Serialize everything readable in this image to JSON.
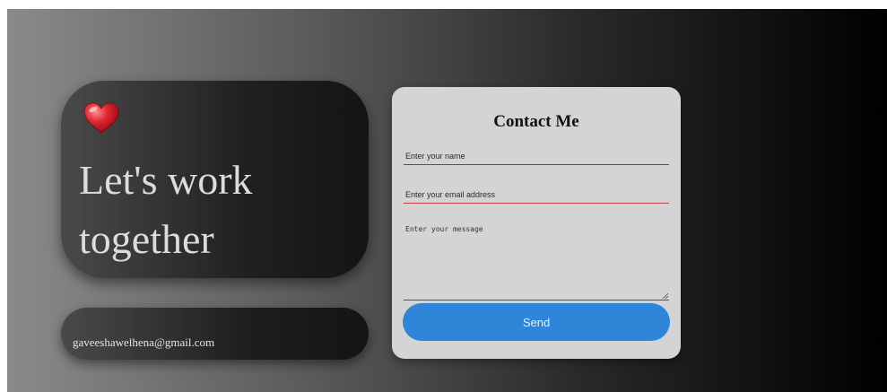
{
  "hero": {
    "icon": "heart-icon",
    "title_line1": "Let's work",
    "title_line2": "together",
    "email": "gaveeshawelhena@gmail.com"
  },
  "contact_form": {
    "title": "Contact Me",
    "name_placeholder": "Enter your name",
    "email_placeholder": "Enter your email address",
    "message_placeholder": "Enter your message",
    "send_label": "Send"
  },
  "colors": {
    "accent_button": "#2f86d9",
    "email_underline": "#c0404a",
    "heart": "#d8232f",
    "form_background": "#d4d4d4"
  }
}
